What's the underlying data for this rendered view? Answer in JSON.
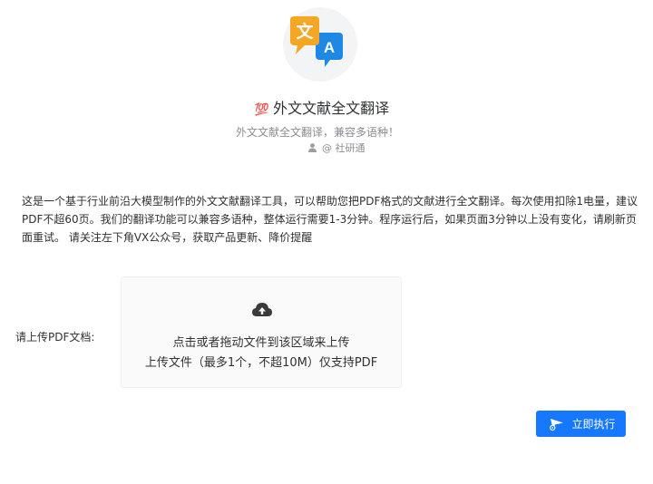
{
  "app": {
    "title_emoji": "💯",
    "title": "外文文献全文翻译",
    "subtitle": "外文文献全文翻译，兼容多语种！",
    "author": "@ 社研通",
    "logo_icon": "translate-icon"
  },
  "description": "这是一个基于行业前沿大模型制作的外文文献翻译工具，可以帮助您把PDF格式的文献进行全文翻译。每次使用扣除1电量，建议PDF不超60页。我们的翻译功能可以兼容多语种，整体运行需要1-3分钟。程序运行后，如果页面3分钟以上没有变化，请刷新页面重试。 请关注左下角VX公众号，获取产品更新、降价提醒",
  "upload": {
    "label": "请上传PDF文档:",
    "hint_line1": "点击或者拖动文件到该区域来上传",
    "hint_line2": "上传文件（最多1个，不超10M）仅支持PDF",
    "icon": "cloud-upload-icon"
  },
  "actions": {
    "run_label": "立即执行",
    "run_icon": "send-icon"
  },
  "colors": {
    "primary": "#1677ff",
    "logo_orange": "#f5a623",
    "logo_blue": "#1e88e5"
  }
}
